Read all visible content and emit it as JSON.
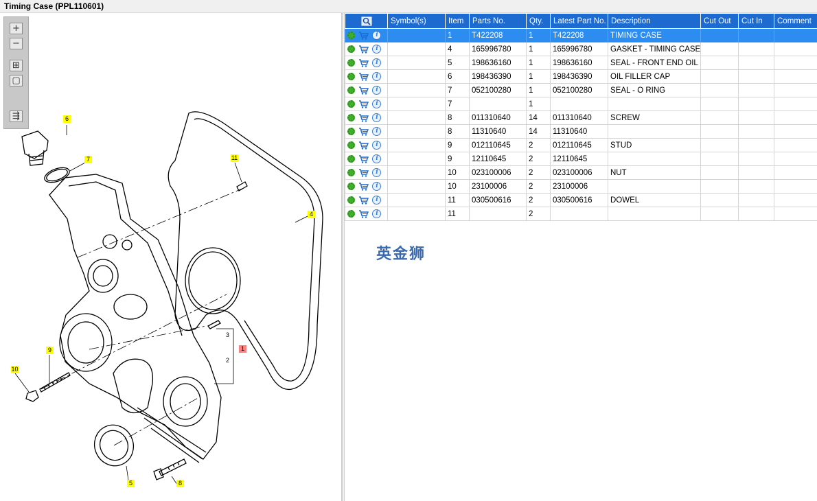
{
  "window": {
    "title": "Timing Case (PPL110601)"
  },
  "toolbar": {
    "buttons": [
      {
        "name": "zoom-in-icon",
        "glyph": "+"
      },
      {
        "name": "zoom-out-icon",
        "glyph": "−"
      },
      {
        "name": "fit-all-icon",
        "glyph": "⊞"
      },
      {
        "name": "fit-window-icon",
        "glyph": "▢"
      },
      {
        "name": "layout-toggle-icon",
        "glyph": "⇶"
      }
    ]
  },
  "callouts": [
    {
      "label": "6",
      "style": "yellow"
    },
    {
      "label": "7",
      "style": "yellow"
    },
    {
      "label": "11",
      "style": "yellow"
    },
    {
      "label": "4",
      "style": "yellow"
    },
    {
      "label": "1",
      "style": "red"
    },
    {
      "label": "3",
      "style": "plain"
    },
    {
      "label": "2",
      "style": "plain"
    },
    {
      "label": "9",
      "style": "yellow"
    },
    {
      "label": "10",
      "style": "yellow"
    },
    {
      "label": "5",
      "style": "yellow"
    },
    {
      "label": "8",
      "style": "yellow"
    }
  ],
  "table": {
    "headers": {
      "symbols": "Symbol(s)",
      "item": "Item",
      "parts_no": "Parts No.",
      "qty": "Qty.",
      "latest": "Latest Part No.",
      "description": "Description",
      "cut_out": "Cut Out",
      "cut_in": "Cut In",
      "comment": "Comment"
    },
    "rows": [
      {
        "item": "1",
        "parts_no": "T422208",
        "qty": "1",
        "latest": "T422208",
        "description": "TIMING CASE",
        "selected": true
      },
      {
        "item": "4",
        "parts_no": "165996780",
        "qty": "1",
        "latest": "165996780",
        "description": "GASKET - TIMING CASE"
      },
      {
        "item": "5",
        "parts_no": "198636160",
        "qty": "1",
        "latest": "198636160",
        "description": "SEAL - FRONT END OIL"
      },
      {
        "item": "6",
        "parts_no": "198436390",
        "qty": "1",
        "latest": "198436390",
        "description": "OIL FILLER CAP"
      },
      {
        "item": "7",
        "parts_no": "052100280",
        "qty": "1",
        "latest": "052100280",
        "description": "SEAL - O RING"
      },
      {
        "item": "7",
        "parts_no": "",
        "qty": "1",
        "latest": "",
        "description": ""
      },
      {
        "item": "8",
        "parts_no": "011310640",
        "qty": "14",
        "latest": "011310640",
        "description": "SCREW"
      },
      {
        "item": "8",
        "parts_no": "11310640",
        "qty": "14",
        "latest": "11310640",
        "description": ""
      },
      {
        "item": "9",
        "parts_no": "012110645",
        "qty": "2",
        "latest": "012110645",
        "description": "STUD"
      },
      {
        "item": "9",
        "parts_no": "12110645",
        "qty": "2",
        "latest": "12110645",
        "description": ""
      },
      {
        "item": "10",
        "parts_no": "023100006",
        "qty": "2",
        "latest": "023100006",
        "description": "NUT"
      },
      {
        "item": "10",
        "parts_no": "23100006",
        "qty": "2",
        "latest": "23100006",
        "description": ""
      },
      {
        "item": "11",
        "parts_no": "030500616",
        "qty": "2",
        "latest": "030500616",
        "description": "DOWEL"
      },
      {
        "item": "11",
        "parts_no": "",
        "qty": "2",
        "latest": "",
        "description": ""
      }
    ]
  },
  "watermark": "英金狮",
  "colors": {
    "header_blue": "#1d6ad0",
    "selected_blue": "#2d8cf0",
    "callout_yellow": "#ffff00",
    "callout_red": "#ff8080"
  }
}
